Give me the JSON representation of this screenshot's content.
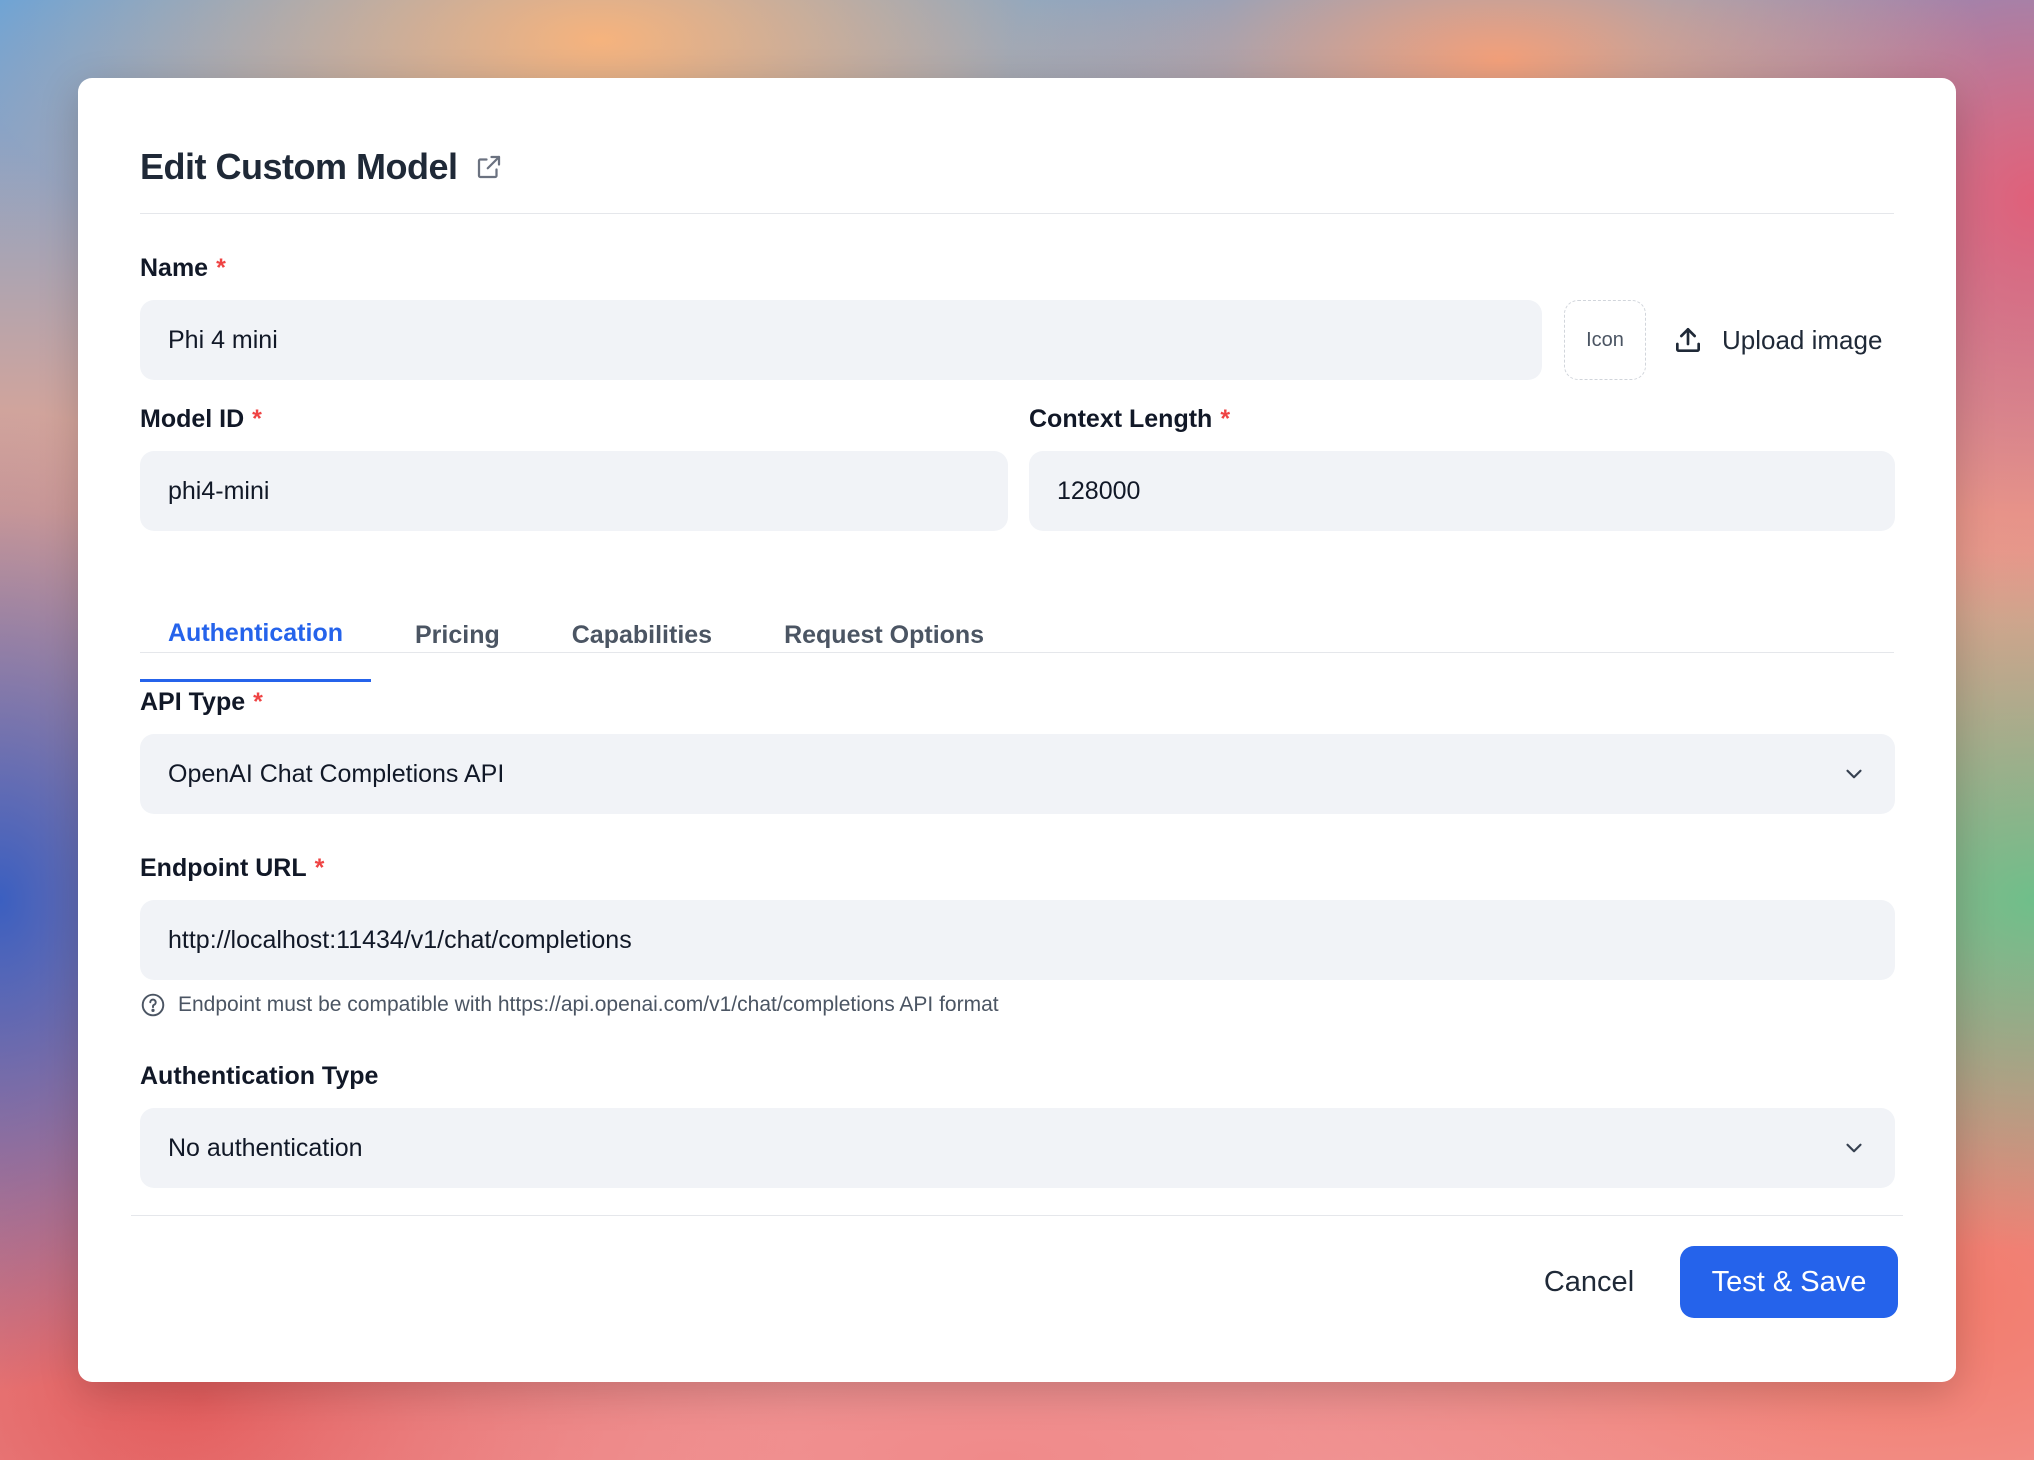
{
  "dialog": {
    "title": "Edit Custom Model"
  },
  "form": {
    "name": {
      "label": "Name",
      "required_mark": "*",
      "value": "Phi 4 mini"
    },
    "icon_placeholder": "Icon",
    "upload_label": "Upload image",
    "model_id": {
      "label": "Model ID",
      "required_mark": "*",
      "value": "phi4-mini"
    },
    "context_length": {
      "label": "Context Length",
      "required_mark": "*",
      "value": "128000"
    }
  },
  "tabs": [
    {
      "label": "Authentication",
      "active": true
    },
    {
      "label": "Pricing",
      "active": false
    },
    {
      "label": "Capabilities",
      "active": false
    },
    {
      "label": "Request Options",
      "active": false
    }
  ],
  "auth": {
    "api_type": {
      "label": "API Type",
      "required_mark": "*",
      "value": "OpenAI Chat Completions API"
    },
    "endpoint_url": {
      "label": "Endpoint URL",
      "required_mark": "*",
      "value": "http://localhost:11434/v1/chat/completions"
    },
    "endpoint_hint": "Endpoint must be compatible with https://api.openai.com/v1/chat/completions API format",
    "auth_type": {
      "label": "Authentication Type",
      "value": "No authentication"
    }
  },
  "footer": {
    "cancel_label": "Cancel",
    "save_label": "Test & Save"
  },
  "colors": {
    "accent": "#2563eb",
    "required": "#ef4444",
    "input_bg": "#f1f3f7"
  },
  "icons": {
    "external_link": "external-link-icon",
    "upload": "upload-icon",
    "chevron": "chevron-down-icon",
    "help": "help-circle-icon"
  }
}
